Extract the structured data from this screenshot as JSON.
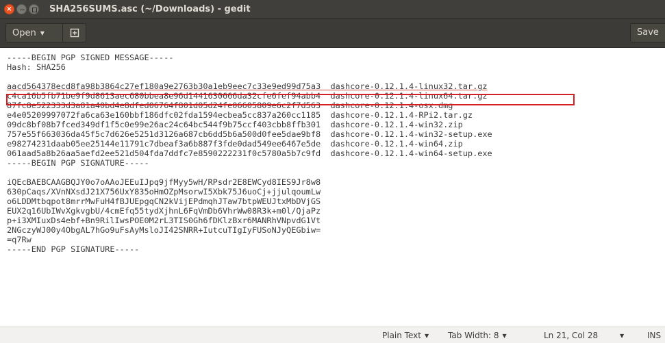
{
  "window": {
    "title": "SHA256SUMS.asc (~/Downloads) - gedit",
    "close_glyph": "×"
  },
  "headerbar": {
    "open_label": "Open",
    "save_label": "Save"
  },
  "editor": {
    "lines": [
      "-----BEGIN PGP SIGNED MESSAGE-----",
      "Hash: SHA256",
      "",
      "aacd564378ecd8fa98b3864c27ef180a9e2763b30a1eb9eec7c33e9ed99d75a3  dashcore-0.12.1.4-linux32.tar.gz",
      "c4ca16b5fb71be9f9d8613aec680bbea8e96d1441630666da32cfe6fef94abb4  dashcore-0.12.1.4-linux64.tar.gz",
      "87fc8e522333d3a81a40bd4e8dfed06764f801d05d24fe06605809e6c2f7d563  dashcore-0.12.1.4-osx.dmg",
      "e4e05209997072fa6ca63e160bbf186dfc02fda1594ecbea5cc837a260cc1185  dashcore-0.12.1.4-RPi2.tar.gz",
      "09dc8bf08b7fced349df1f5c0e99e26ac24c64bc544f9b75ccf403cbb8ffb301  dashcore-0.12.1.4-win32.zip",
      "757e55f663036da45f5c7d626e5251d3126a687cb6dd5b6a500d0fee5dae9bf8  dashcore-0.12.1.4-win32-setup.exe",
      "e98274231daab05ee25144e11791c7dbeaf3a6b887f3fde0dad549ee6467e5de  dashcore-0.12.1.4-win64.zip",
      "061aad5a8b26aa5aefd2ee521d504fda7ddfc7e8590222231f0c5780a5b7c9fd  dashcore-0.12.1.4-win64-setup.exe",
      "-----BEGIN PGP SIGNATURE-----",
      "",
      "iQEcBAEBCAAGBQJY0o7oAAoJEEuIJpq9jfMyy5wH/RPsdr2E8EWCyd8IES9Jr8w8",
      "630pCaqs/XVnNXsdJ21X756UxY835oHmOZpMsorwI5Xbk75J6uoCj+jjulqoumLw",
      "o6LDDMtbqpot8mrrMwFuH4fBJUEpgqCN2kVijEPdmqhJTaw7btpWEUJtxMbDVjGS",
      "EUX2q16UbIWvXgkvgbU/4cmEfq55tydXjhnL6FqVmDb6VhrWw08R3k+m0l/QjaPz",
      "p+i3XMIuxDs4ebf+Bn9RilIwsPOE0M2rL3TIS0Gh6fDKlzBxr6MANRhVNpvdG1Vt",
      "2NGczyWJ00y4ObgAL7hGo9uFsAyMsloJI42SNRR+IutcuTIgIyFUSoNJyQEGbiw=",
      "=q7Rw",
      "-----END PGP SIGNATURE-----"
    ]
  },
  "statusbar": {
    "language": "Plain Text",
    "tab_width": "Tab Width: 8",
    "position": "Ln 21, Col 28",
    "mode": "INS"
  },
  "colors": {
    "titlebar": "#403f3b",
    "headerbar": "#3c3b37",
    "highlight_box": "#d41f25",
    "close_button": "#e95420"
  }
}
